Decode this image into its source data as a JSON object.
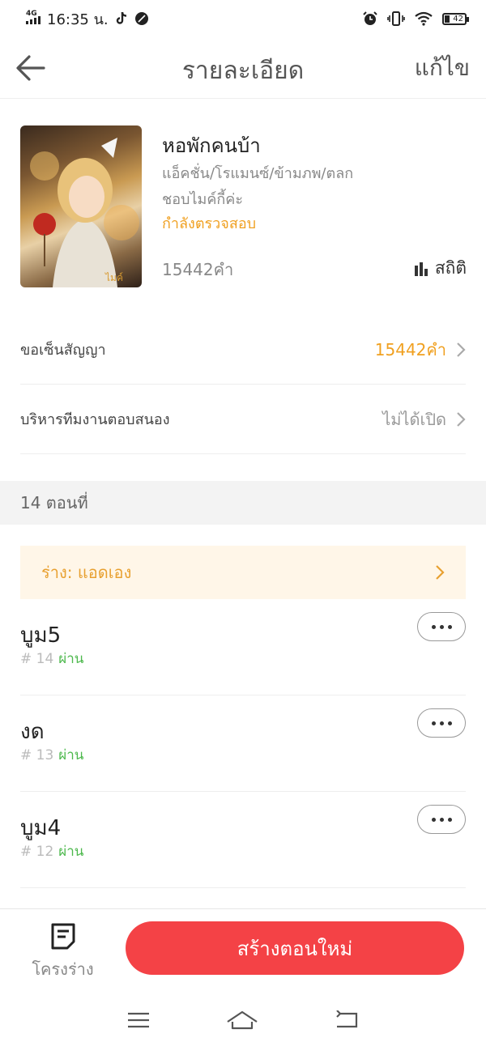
{
  "status_bar": {
    "network": "4G",
    "time": "16:35 น.",
    "battery": "42"
  },
  "header": {
    "title": "รายละเอียด",
    "edit_label": "แก้ไข"
  },
  "book": {
    "title": "หอพักคนบ้า",
    "genres": "แอ็คชั่น/โรแมนซ์/ข้ามภพ/ตลก",
    "author": "ชอบไมค์กี้ค่ะ",
    "status": "กำลังตรวจสอบ",
    "word_count": "15442คำ",
    "stats_label": "สถิติ"
  },
  "settings": [
    {
      "label": "ขอเซ็นสัญญา",
      "value": "15442คำ",
      "value_color": "#f0a020"
    },
    {
      "label": "บริหารทีมงานตอบสนอง",
      "value": "ไม่ได้เปิด",
      "value_color": "#999999"
    }
  ],
  "chapters_header": "14 ตอนที่",
  "draft": {
    "label": "ร่าง: แอดเอง"
  },
  "chapters": [
    {
      "title": "บูม5",
      "number": "# 14",
      "status": "ผ่าน"
    },
    {
      "title": "งด",
      "number": "# 13",
      "status": "ผ่าน"
    },
    {
      "title": "บูม4",
      "number": "# 12",
      "status": "ผ่าน"
    }
  ],
  "bottom_bar": {
    "outline_label": "โครงร่าง",
    "create_label": "สร้างตอนใหม่"
  },
  "colors": {
    "accent_orange": "#f0a020",
    "pass_green": "#4cb84c",
    "create_red": "#f44246",
    "draft_bg": "#fff6e8"
  }
}
